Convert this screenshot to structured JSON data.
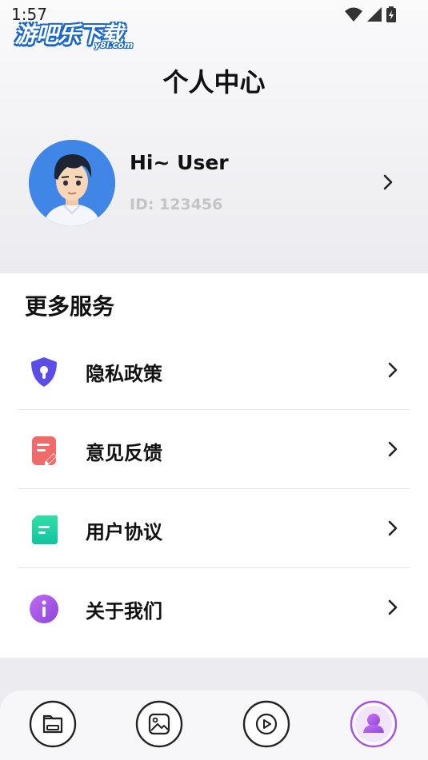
{
  "status_bar": {
    "time": "1:57"
  },
  "watermark": {
    "text": "游吧乐下载",
    "sub": "y8l.com"
  },
  "header": {
    "title": "个人中心"
  },
  "profile": {
    "name": "Hi~ User",
    "id": "ID: 123456"
  },
  "services": {
    "title": "更多服务",
    "items": [
      {
        "label": "隐私政策",
        "icon": "shield-icon",
        "color": "#5b4ee8"
      },
      {
        "label": "意见反馈",
        "icon": "feedback-note-icon",
        "color": "#f06a6a"
      },
      {
        "label": "用户协议",
        "icon": "agreement-doc-icon",
        "color": "#1fd2a4"
      },
      {
        "label": "关于我们",
        "icon": "info-icon",
        "color": "#a555e6"
      }
    ]
  },
  "bottom_nav": {
    "items": [
      {
        "icon": "files-icon"
      },
      {
        "icon": "image-icon"
      },
      {
        "icon": "video-play-icon"
      },
      {
        "icon": "profile-icon",
        "active": true,
        "color": "#a64ee6"
      }
    ]
  }
}
